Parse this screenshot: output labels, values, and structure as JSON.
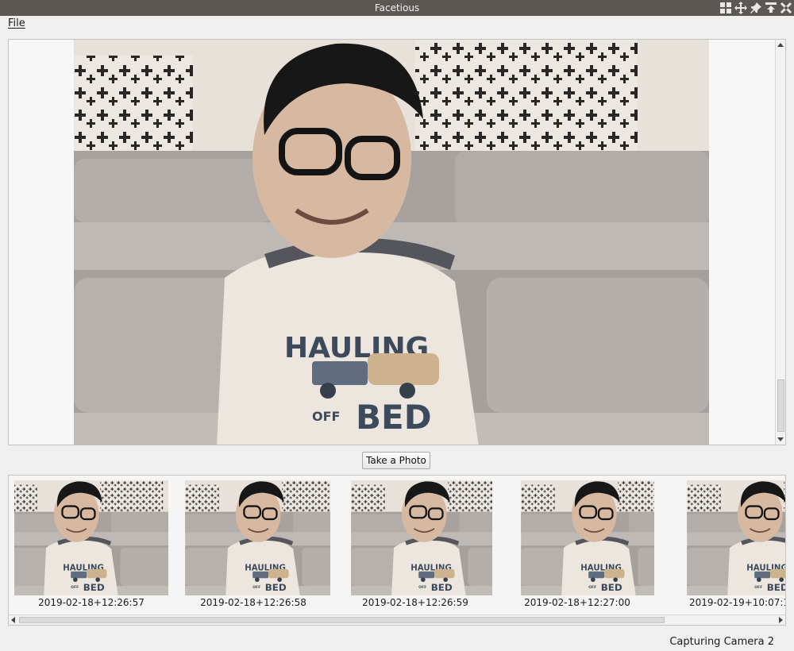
{
  "window": {
    "title": "Facetious",
    "controls": [
      "grid-icon",
      "move-icon",
      "pin-icon",
      "maximize-icon",
      "close-icon"
    ]
  },
  "menu": {
    "items": [
      {
        "label": "File"
      }
    ]
  },
  "main": {
    "take_photo_label": "Take a Photo",
    "preview_icon": "camera-preview"
  },
  "gallery": {
    "photos": [
      {
        "caption": "2019-02-18+12:26:57"
      },
      {
        "caption": "2019-02-18+12:26:58"
      },
      {
        "caption": "2019-02-18+12:26:59"
      },
      {
        "caption": "2019-02-18+12:27:00"
      },
      {
        "caption": "2019-02-19+10:07:1"
      }
    ]
  },
  "status": {
    "text": "Capturing Camera 2"
  },
  "colors": {
    "titlebar": "#5b5752",
    "window_bg": "#efefef",
    "shirt_text": "#3d4a5c"
  }
}
